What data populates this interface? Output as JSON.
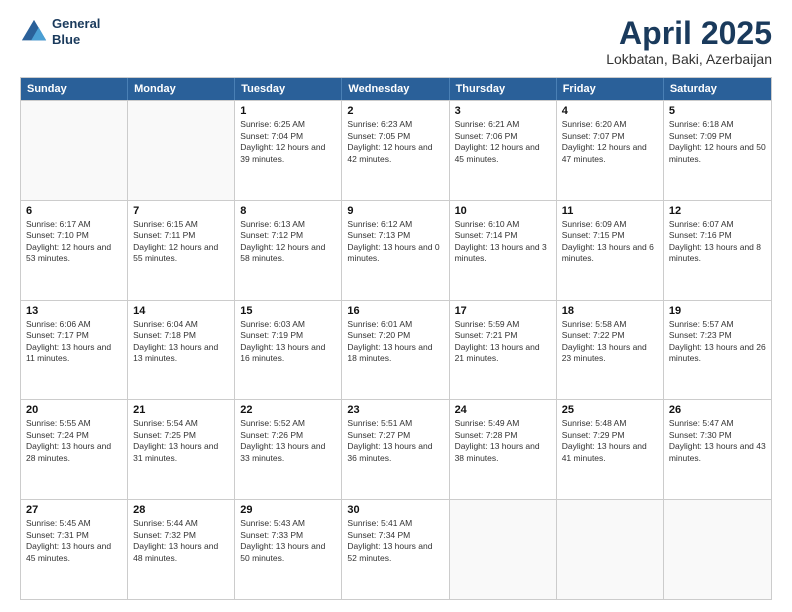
{
  "header": {
    "logo_line1": "General",
    "logo_line2": "Blue",
    "month": "April 2025",
    "location": "Lokbatan, Baki, Azerbaijan"
  },
  "days_of_week": [
    "Sunday",
    "Monday",
    "Tuesday",
    "Wednesday",
    "Thursday",
    "Friday",
    "Saturday"
  ],
  "weeks": [
    [
      {
        "day": "",
        "sunrise": "",
        "sunset": "",
        "daylight": ""
      },
      {
        "day": "",
        "sunrise": "",
        "sunset": "",
        "daylight": ""
      },
      {
        "day": "1",
        "sunrise": "Sunrise: 6:25 AM",
        "sunset": "Sunset: 7:04 PM",
        "daylight": "Daylight: 12 hours and 39 minutes."
      },
      {
        "day": "2",
        "sunrise": "Sunrise: 6:23 AM",
        "sunset": "Sunset: 7:05 PM",
        "daylight": "Daylight: 12 hours and 42 minutes."
      },
      {
        "day": "3",
        "sunrise": "Sunrise: 6:21 AM",
        "sunset": "Sunset: 7:06 PM",
        "daylight": "Daylight: 12 hours and 45 minutes."
      },
      {
        "day": "4",
        "sunrise": "Sunrise: 6:20 AM",
        "sunset": "Sunset: 7:07 PM",
        "daylight": "Daylight: 12 hours and 47 minutes."
      },
      {
        "day": "5",
        "sunrise": "Sunrise: 6:18 AM",
        "sunset": "Sunset: 7:09 PM",
        "daylight": "Daylight: 12 hours and 50 minutes."
      }
    ],
    [
      {
        "day": "6",
        "sunrise": "Sunrise: 6:17 AM",
        "sunset": "Sunset: 7:10 PM",
        "daylight": "Daylight: 12 hours and 53 minutes."
      },
      {
        "day": "7",
        "sunrise": "Sunrise: 6:15 AM",
        "sunset": "Sunset: 7:11 PM",
        "daylight": "Daylight: 12 hours and 55 minutes."
      },
      {
        "day": "8",
        "sunrise": "Sunrise: 6:13 AM",
        "sunset": "Sunset: 7:12 PM",
        "daylight": "Daylight: 12 hours and 58 minutes."
      },
      {
        "day": "9",
        "sunrise": "Sunrise: 6:12 AM",
        "sunset": "Sunset: 7:13 PM",
        "daylight": "Daylight: 13 hours and 0 minutes."
      },
      {
        "day": "10",
        "sunrise": "Sunrise: 6:10 AM",
        "sunset": "Sunset: 7:14 PM",
        "daylight": "Daylight: 13 hours and 3 minutes."
      },
      {
        "day": "11",
        "sunrise": "Sunrise: 6:09 AM",
        "sunset": "Sunset: 7:15 PM",
        "daylight": "Daylight: 13 hours and 6 minutes."
      },
      {
        "day": "12",
        "sunrise": "Sunrise: 6:07 AM",
        "sunset": "Sunset: 7:16 PM",
        "daylight": "Daylight: 13 hours and 8 minutes."
      }
    ],
    [
      {
        "day": "13",
        "sunrise": "Sunrise: 6:06 AM",
        "sunset": "Sunset: 7:17 PM",
        "daylight": "Daylight: 13 hours and 11 minutes."
      },
      {
        "day": "14",
        "sunrise": "Sunrise: 6:04 AM",
        "sunset": "Sunset: 7:18 PM",
        "daylight": "Daylight: 13 hours and 13 minutes."
      },
      {
        "day": "15",
        "sunrise": "Sunrise: 6:03 AM",
        "sunset": "Sunset: 7:19 PM",
        "daylight": "Daylight: 13 hours and 16 minutes."
      },
      {
        "day": "16",
        "sunrise": "Sunrise: 6:01 AM",
        "sunset": "Sunset: 7:20 PM",
        "daylight": "Daylight: 13 hours and 18 minutes."
      },
      {
        "day": "17",
        "sunrise": "Sunrise: 5:59 AM",
        "sunset": "Sunset: 7:21 PM",
        "daylight": "Daylight: 13 hours and 21 minutes."
      },
      {
        "day": "18",
        "sunrise": "Sunrise: 5:58 AM",
        "sunset": "Sunset: 7:22 PM",
        "daylight": "Daylight: 13 hours and 23 minutes."
      },
      {
        "day": "19",
        "sunrise": "Sunrise: 5:57 AM",
        "sunset": "Sunset: 7:23 PM",
        "daylight": "Daylight: 13 hours and 26 minutes."
      }
    ],
    [
      {
        "day": "20",
        "sunrise": "Sunrise: 5:55 AM",
        "sunset": "Sunset: 7:24 PM",
        "daylight": "Daylight: 13 hours and 28 minutes."
      },
      {
        "day": "21",
        "sunrise": "Sunrise: 5:54 AM",
        "sunset": "Sunset: 7:25 PM",
        "daylight": "Daylight: 13 hours and 31 minutes."
      },
      {
        "day": "22",
        "sunrise": "Sunrise: 5:52 AM",
        "sunset": "Sunset: 7:26 PM",
        "daylight": "Daylight: 13 hours and 33 minutes."
      },
      {
        "day": "23",
        "sunrise": "Sunrise: 5:51 AM",
        "sunset": "Sunset: 7:27 PM",
        "daylight": "Daylight: 13 hours and 36 minutes."
      },
      {
        "day": "24",
        "sunrise": "Sunrise: 5:49 AM",
        "sunset": "Sunset: 7:28 PM",
        "daylight": "Daylight: 13 hours and 38 minutes."
      },
      {
        "day": "25",
        "sunrise": "Sunrise: 5:48 AM",
        "sunset": "Sunset: 7:29 PM",
        "daylight": "Daylight: 13 hours and 41 minutes."
      },
      {
        "day": "26",
        "sunrise": "Sunrise: 5:47 AM",
        "sunset": "Sunset: 7:30 PM",
        "daylight": "Daylight: 13 hours and 43 minutes."
      }
    ],
    [
      {
        "day": "27",
        "sunrise": "Sunrise: 5:45 AM",
        "sunset": "Sunset: 7:31 PM",
        "daylight": "Daylight: 13 hours and 45 minutes."
      },
      {
        "day": "28",
        "sunrise": "Sunrise: 5:44 AM",
        "sunset": "Sunset: 7:32 PM",
        "daylight": "Daylight: 13 hours and 48 minutes."
      },
      {
        "day": "29",
        "sunrise": "Sunrise: 5:43 AM",
        "sunset": "Sunset: 7:33 PM",
        "daylight": "Daylight: 13 hours and 50 minutes."
      },
      {
        "day": "30",
        "sunrise": "Sunrise: 5:41 AM",
        "sunset": "Sunset: 7:34 PM",
        "daylight": "Daylight: 13 hours and 52 minutes."
      },
      {
        "day": "",
        "sunrise": "",
        "sunset": "",
        "daylight": ""
      },
      {
        "day": "",
        "sunrise": "",
        "sunset": "",
        "daylight": ""
      },
      {
        "day": "",
        "sunrise": "",
        "sunset": "",
        "daylight": ""
      }
    ]
  ]
}
